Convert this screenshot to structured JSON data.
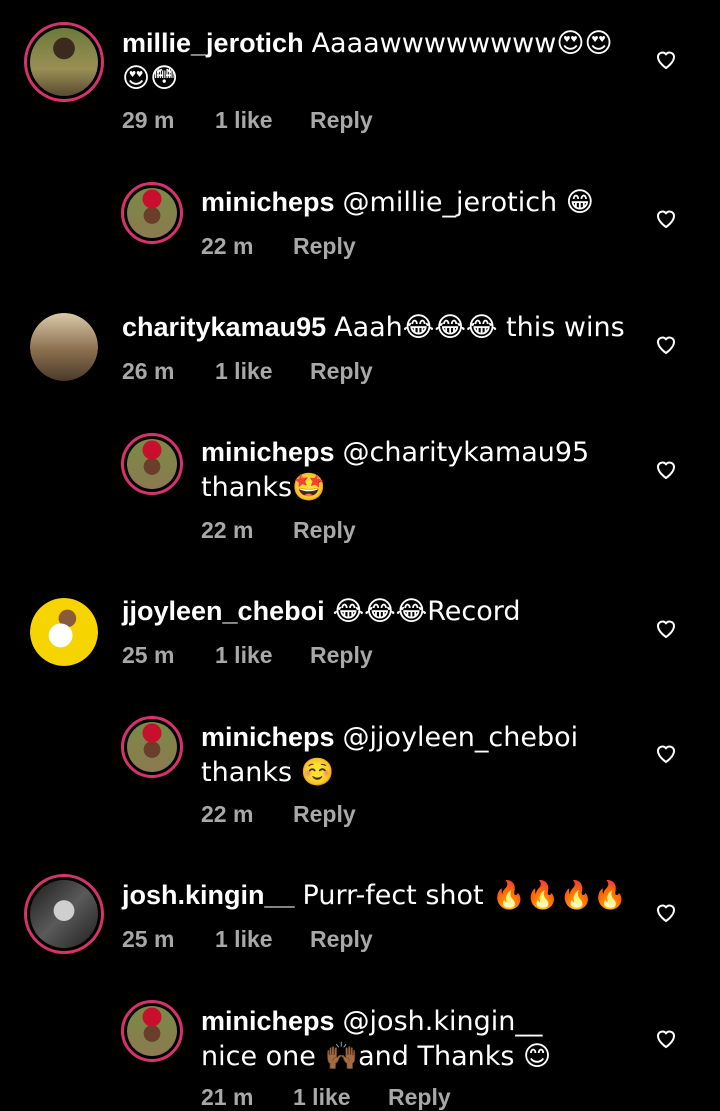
{
  "comments": [
    {
      "user": "millie_jerotich",
      "text": "Aaaawwwwwwww😍😍😍😳",
      "time": "29 m",
      "likes": "1 like",
      "reply": "Reply"
    },
    {
      "user": "minicheps",
      "text": "@millie_jerotich 😁",
      "time": "22 m",
      "likes": "",
      "reply": "Reply"
    },
    {
      "user": "charitykamau95",
      "text": "Aaah😂😂😂 this wins",
      "time": "26 m",
      "likes": "1 like",
      "reply": "Reply"
    },
    {
      "user": "minicheps",
      "text": "@charitykamau95 thanks🤩",
      "time": "22 m",
      "likes": "",
      "reply": "Reply"
    },
    {
      "user": "jjoyleen_cheboi",
      "text": "😂😂😂Record",
      "time": "25 m",
      "likes": "1 like",
      "reply": "Reply"
    },
    {
      "user": "minicheps",
      "text": "@jjoyleen_cheboi thanks ☺️",
      "time": "22 m",
      "likes": "",
      "reply": "Reply"
    },
    {
      "user": "josh.kingin__",
      "text": "Purr-fect shot 🔥🔥🔥🔥",
      "time": "25 m",
      "likes": "1 like",
      "reply": "Reply"
    },
    {
      "user": "minicheps",
      "text": "@josh.kingin__ nice one 🙌🏾and Thanks 😊",
      "time": "21 m",
      "likes": "1 like",
      "reply": "Reply"
    }
  ],
  "colors": {
    "story_ring": "#d6336c",
    "meta": "#a8a8a8"
  },
  "icons": {
    "like": "heart-outline-icon"
  }
}
